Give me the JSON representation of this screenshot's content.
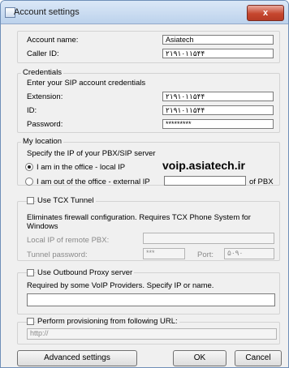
{
  "window": {
    "title": "Account settings",
    "close_symbol": "x"
  },
  "account": {
    "name_label": "Account name:",
    "name_value": "Asiatech",
    "caller_label": "Caller ID:",
    "caller_value": "۲۱۹۱۰۱۱۵۴۴"
  },
  "credentials": {
    "legend": "Credentials",
    "hint": "Enter your SIP account credentials",
    "extension_label": "Extension:",
    "extension_value": "۲۱۹۱۰۱۱۵۴۴",
    "id_label": "ID:",
    "id_value": "۲۱۹۱۰۱۱۵۴۴",
    "password_label": "Password:",
    "password_value": "*********"
  },
  "location": {
    "legend": "My location",
    "hint": "Specify the IP of your PBX/SIP server",
    "local_label": "I am in the office - local IP",
    "local_value": "voip.asiatech.ir",
    "external_label": "I am out of the office - external IP",
    "external_value": "",
    "of_pbx": "of PBX"
  },
  "tunnel": {
    "label": "Use TCX Tunnel",
    "description": "Eliminates firewall configuration. Requires TCX Phone System for Windows",
    "remote_ip_label": "Local IP of remote PBX:",
    "remote_ip_value": "",
    "password_label": "Tunnel password:",
    "password_value": "***",
    "port_label": "Port:",
    "port_value": "۵۰۹۰"
  },
  "proxy": {
    "label": "Use Outbound Proxy server",
    "description": "Required by some VoIP Providers. Specify IP or name.",
    "value": ""
  },
  "provisioning": {
    "label": "Perform provisioning from following URL:",
    "value": "http://"
  },
  "buttons": {
    "advanced": "Advanced settings",
    "ok": "OK",
    "cancel": "Cancel"
  }
}
